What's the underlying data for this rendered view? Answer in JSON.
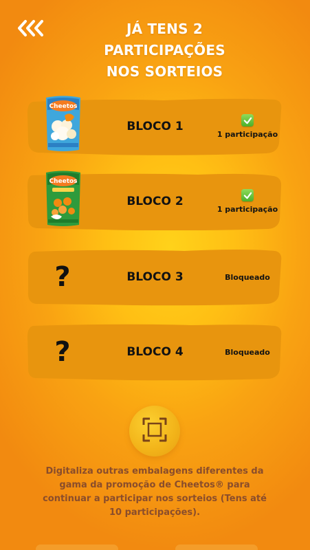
{
  "header": {
    "back_icon": "chevron-triple-left-icon",
    "title_lines": [
      "JÁ TENS 2",
      "PARTICIPAÇÕES",
      "NOS SORTEIOS"
    ]
  },
  "blocks": [
    {
      "label": "BLOCO 1",
      "status": "1 participação",
      "state": "unlocked",
      "product": "cheetos-popcorn-bag"
    },
    {
      "label": "BLOCO 2",
      "status": "1 participação",
      "state": "unlocked",
      "product": "cheetos-green-bag"
    },
    {
      "label": "BLOCO 3",
      "status": "Bloqueado",
      "state": "locked",
      "placeholder": "?"
    },
    {
      "label": "BLOCO 4",
      "status": "Bloqueado",
      "state": "locked",
      "placeholder": "?"
    }
  ],
  "scan_button": {
    "icon": "scan-frame-icon"
  },
  "info_text": "Digitaliza outras embalagens diferentes da gama da promoção de Cheetos® para continuar a participar nos sorteios (Tens até 10 participações).",
  "colors": {
    "background_center": "#ffd21a",
    "background_edge": "#f28a10",
    "card": "#e8950e",
    "text_dark": "#121212",
    "info_text": "#8a4d2b",
    "check_green": "#4caf2a"
  }
}
